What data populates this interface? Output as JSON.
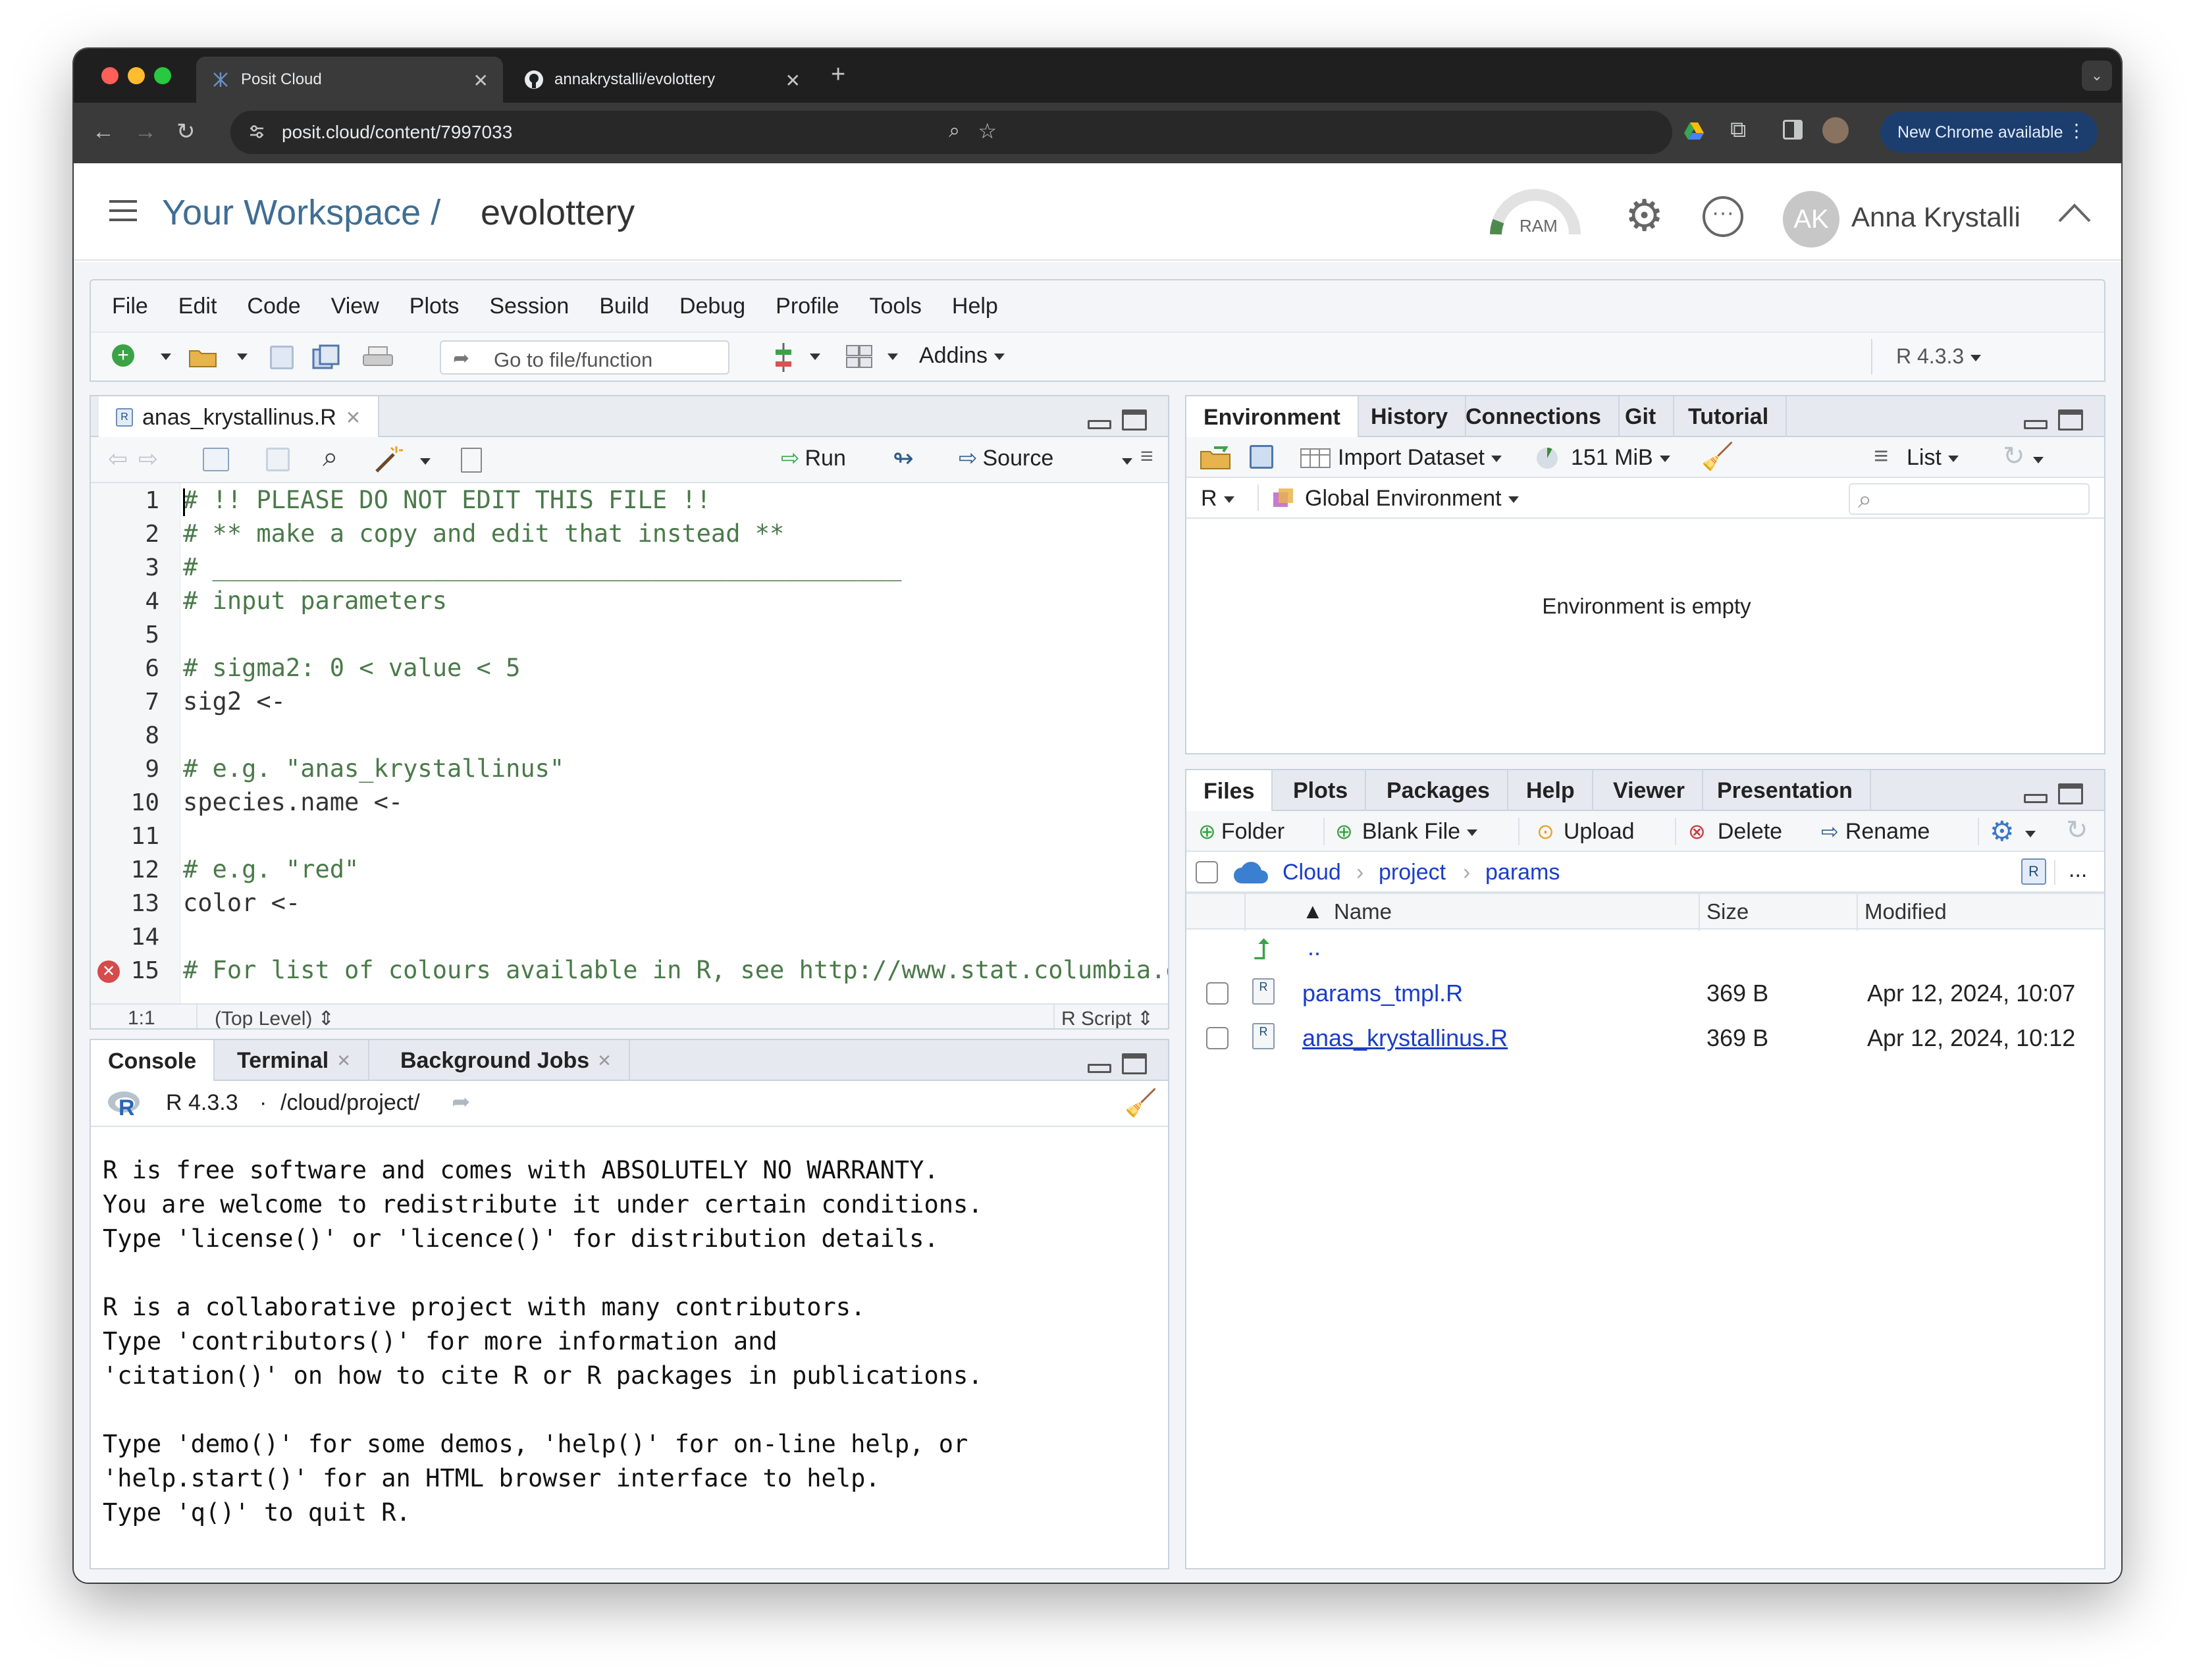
{
  "browser": {
    "tabs": [
      {
        "title": "Posit Cloud"
      },
      {
        "title": "annakrystalli/evolottery"
      }
    ],
    "new_tab": "+",
    "url": "posit.cloud/content/7997033",
    "new_chrome": "New Chrome available"
  },
  "header": {
    "workspace": "Your Workspace /",
    "project": "evolottery",
    "ram": "RAM",
    "avatar_initials": "AK",
    "user_name": "Anna Krystalli"
  },
  "menu": [
    "File",
    "Edit",
    "Code",
    "View",
    "Plots",
    "Session",
    "Build",
    "Debug",
    "Profile",
    "Tools",
    "Help"
  ],
  "toolbar": {
    "goto_placeholder": "Go to file/function",
    "addins": "Addins",
    "r_version": "R 4.3.3"
  },
  "editor": {
    "tab": "anas_krystallinus.R",
    "run": "Run",
    "source": "Source",
    "lines": [
      {
        "n": "1",
        "text": "# !! PLEASE DO NOT EDIT THIS FILE !!",
        "comment": true
      },
      {
        "n": "2",
        "text": "# ** make a copy and edit that instead **",
        "comment": true
      },
      {
        "n": "3",
        "text": "# _______________________________________________",
        "comment": true
      },
      {
        "n": "4",
        "text": "# input parameters",
        "comment": true
      },
      {
        "n": "5",
        "text": "",
        "comment": false
      },
      {
        "n": "6",
        "text": "# sigma2: 0 < value < 5",
        "comment": true
      },
      {
        "n": "7",
        "text": "sig2 <-",
        "comment": false
      },
      {
        "n": "8",
        "text": "",
        "comment": false
      },
      {
        "n": "9",
        "text": "# e.g. \"anas_krystallinus\"",
        "comment": true
      },
      {
        "n": "10",
        "text": "species.name <-",
        "comment": false
      },
      {
        "n": "11",
        "text": "",
        "comment": false
      },
      {
        "n": "12",
        "text": "# e.g. \"red\"",
        "comment": true
      },
      {
        "n": "13",
        "text": "color <-",
        "comment": false
      },
      {
        "n": "14",
        "text": "",
        "comment": false
      },
      {
        "n": "15",
        "text": "# For list of colours available in R, see http://www.stat.columbia.ec",
        "comment": true
      }
    ],
    "status_pos": "1:1",
    "status_scope": "(Top Level)",
    "status_type": "R Script"
  },
  "console": {
    "tabs": [
      "Console",
      "Terminal",
      "Background Jobs"
    ],
    "r_version": "R 4.3.3",
    "dot": "·",
    "path": "/cloud/project/",
    "lines": [
      "",
      "R is free software and comes with ABSOLUTELY NO WARRANTY.",
      "You are welcome to redistribute it under certain conditions.",
      "Type 'license()' or 'licence()' for distribution details.",
      "",
      "R is a collaborative project with many contributors.",
      "Type 'contributors()' for more information and",
      "'citation()' on how to cite R or R packages in publications.",
      "",
      "Type 'demo()' for some demos, 'help()' for on-line help, or",
      "'help.start()' for an HTML browser interface to help.",
      "Type 'q()' to quit R."
    ]
  },
  "environment": {
    "tabs": [
      "Environment",
      "History",
      "Connections",
      "Git",
      "Tutorial"
    ],
    "import_dataset": "Import Dataset",
    "memory": "151 MiB",
    "view_mode": "List",
    "language": "R",
    "scope": "Global Environment",
    "empty_message": "Environment is empty"
  },
  "files": {
    "tabs": [
      "Files",
      "Plots",
      "Packages",
      "Help",
      "Viewer",
      "Presentation"
    ],
    "actions": {
      "folder": "Folder",
      "blank_file": "Blank File",
      "upload": "Upload",
      "delete": "Delete",
      "rename": "Rename"
    },
    "breadcrumb": [
      "Cloud",
      "project",
      "params"
    ],
    "more": "...",
    "columns": {
      "name": "Name",
      "size": "Size",
      "modified": "Modified"
    },
    "parent": "..",
    "rows": [
      {
        "name": "params_tmpl.R",
        "size": "369 B",
        "modified": "Apr 12, 2024, 10:07"
      },
      {
        "name": "anas_krystallinus.R",
        "size": "369 B",
        "modified": "Apr 12, 2024, 10:12"
      }
    ]
  },
  "colors": {
    "brand_blue": "#3f6e94",
    "comment_green": "#4a7a4a",
    "link_blue": "#1a3dc9",
    "chrome_dark": "#1f1f1f"
  }
}
